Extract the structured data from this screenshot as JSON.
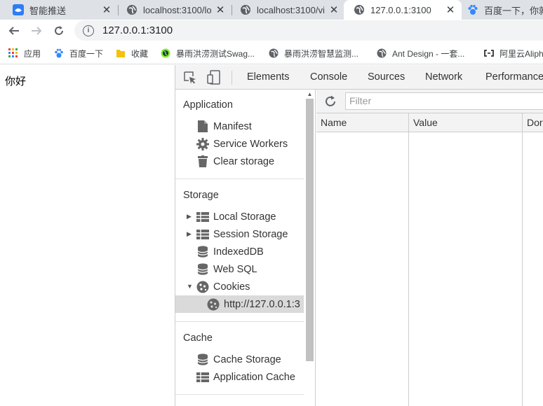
{
  "browser": {
    "tabs": [
      {
        "title": "智能推送",
        "close": "✕"
      },
      {
        "title": "localhost:3100/lo",
        "close": "✕"
      },
      {
        "title": "localhost:3100/vi",
        "close": "✕"
      },
      {
        "title": "127.0.0.1:3100",
        "close": "✕"
      },
      {
        "title": "百度一下，你就"
      }
    ],
    "address": "127.0.0.1:3100",
    "bookmarks": [
      {
        "label": "应用",
        "icon": "apps-grid-icon"
      },
      {
        "label": "百度一下",
        "icon": "baidu-paw-icon"
      },
      {
        "label": "收藏",
        "icon": "folder-icon"
      },
      {
        "label": "暴雨洪涝测试Swag...",
        "icon": "swagger-icon"
      },
      {
        "label": "暴雨洪涝智慧监测...",
        "icon": "globe-icon"
      },
      {
        "label": "Ant Design - 一套...",
        "icon": "globe-icon"
      },
      {
        "label": "阿里云Aliph",
        "icon": "aliyun-icon"
      }
    ]
  },
  "page": {
    "text": "你好"
  },
  "devtools": {
    "tabs": [
      "Elements",
      "Console",
      "Sources",
      "Network",
      "Performance"
    ],
    "sidebar": {
      "application": {
        "title": "Application",
        "items": [
          {
            "label": "Manifest",
            "icon": "file-icon"
          },
          {
            "label": "Service Workers",
            "icon": "gear-icon"
          },
          {
            "label": "Clear storage",
            "icon": "trash-icon"
          }
        ]
      },
      "storage": {
        "title": "Storage",
        "items": [
          {
            "label": "Local Storage",
            "icon": "table-icon"
          },
          {
            "label": "Session Storage",
            "icon": "table-icon"
          },
          {
            "label": "IndexedDB",
            "icon": "database-icon"
          },
          {
            "label": "Web SQL",
            "icon": "database-icon"
          },
          {
            "label": "Cookies",
            "icon": "cookie-icon"
          },
          {
            "label": "http://127.0.0.1:3",
            "icon": "cookie-icon"
          }
        ]
      },
      "cache": {
        "title": "Cache",
        "items": [
          {
            "label": "Cache Storage",
            "icon": "database-icon"
          },
          {
            "label": "Application Cache",
            "icon": "table-icon"
          }
        ]
      }
    },
    "filter_placeholder": "Filter",
    "columns": [
      "Name",
      "Value",
      "Dor"
    ]
  },
  "colors": {
    "tabstrip": "#dee1e6",
    "selected_row": "#dadada",
    "icon_gray": "#666666"
  }
}
